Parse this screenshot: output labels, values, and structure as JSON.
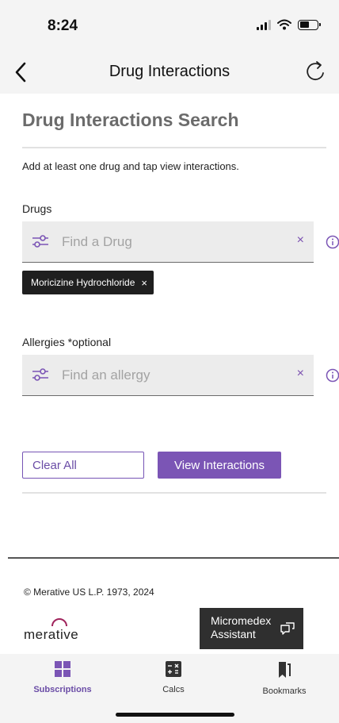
{
  "status_bar": {
    "time": "8:24"
  },
  "nav": {
    "title": "Drug Interactions"
  },
  "page": {
    "heading": "Drug Interactions Search",
    "instruction": "Add at least one drug and tap view interactions."
  },
  "drugs": {
    "label": "Drugs",
    "placeholder": "Find a Drug",
    "clear": "×",
    "selected": [
      {
        "name": "Moricizine Hydrochloride",
        "remove": "×"
      }
    ]
  },
  "allergies": {
    "label": "Allergies *optional",
    "placeholder": "Find an allergy",
    "clear": "×"
  },
  "actions": {
    "clear_all": "Clear All",
    "view_interactions": "View Interactions"
  },
  "footer": {
    "copyright": "© Merative US L.P. 1973, 2024",
    "logo_text": "merative",
    "assistant_line1": "Micromedex",
    "assistant_line2": "Assistant"
  },
  "tabs": [
    {
      "label": "Subscriptions",
      "icon": "grid-icon",
      "active": true
    },
    {
      "label": "Calcs",
      "icon": "calculator-icon",
      "active": false
    },
    {
      "label": "Bookmarks",
      "icon": "bookmark-icon",
      "active": false
    }
  ],
  "colors": {
    "accent": "#7b55b5",
    "heading": "#6b6b6b",
    "chip_bg": "#1f1f1f"
  }
}
